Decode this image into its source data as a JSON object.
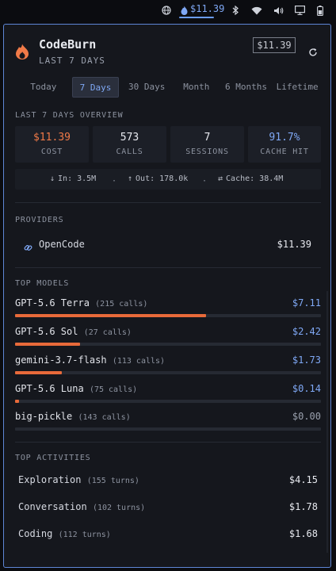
{
  "menubar": {
    "amount": "$11.39",
    "icons": [
      "globe-icon",
      "flame-icon",
      "bluetooth-icon",
      "wifi-icon",
      "volume-icon",
      "display-icon",
      "battery-icon"
    ]
  },
  "header": {
    "title": "CodeBurn",
    "subtitle": "LAST 7 DAYS",
    "total": "$11.39"
  },
  "tabs": [
    {
      "label": "Today",
      "active": false
    },
    {
      "label": "7 Days",
      "active": true
    },
    {
      "label": "30 Days",
      "active": false
    },
    {
      "label": "Month",
      "active": false
    },
    {
      "label": "6 Months",
      "active": false
    },
    {
      "label": "Lifetime",
      "active": false
    }
  ],
  "overview": {
    "heading": "LAST 7 DAYS OVERVIEW",
    "stats": [
      {
        "value": "$11.39",
        "label": "COST",
        "color": "#f07a48"
      },
      {
        "value": "573",
        "label": "CALLS",
        "color": "#e8eaf0"
      },
      {
        "value": "7",
        "label": "SESSIONS",
        "color": "#e8eaf0"
      },
      {
        "value": "91.7%",
        "label": "CACHE HIT",
        "color": "#7fa8f5"
      }
    ],
    "tokens": {
      "in": "In: 3.5M",
      "out": "Out: 178.0k",
      "cache": "Cache: 38.4M",
      "sep": "·"
    }
  },
  "providers": {
    "heading": "PROVIDERS",
    "items": [
      {
        "name": "OpenCode",
        "cost": "$11.39"
      }
    ]
  },
  "models": {
    "heading": "TOP MODELS",
    "items": [
      {
        "name": "GPT-5.6 Terra",
        "calls": "(215 calls)",
        "cost": "$7.11",
        "share": 0.624
      },
      {
        "name": "GPT-5.6 Sol",
        "calls": "(27 calls)",
        "cost": "$2.42",
        "share": 0.212
      },
      {
        "name": "gemini-3.7-flash",
        "calls": "(113 calls)",
        "cost": "$1.73",
        "share": 0.152
      },
      {
        "name": "GPT-5.6 Luna",
        "calls": "(75 calls)",
        "cost": "$0.14",
        "share": 0.012
      },
      {
        "name": "big-pickle",
        "calls": "(143 calls)",
        "cost": "$0.00",
        "share": 0
      }
    ]
  },
  "activities": {
    "heading": "TOP ACTIVITIES",
    "items": [
      {
        "name": "Exploration",
        "turns": "(155 turns)",
        "cost": "$4.15"
      },
      {
        "name": "Conversation",
        "turns": "(102 turns)",
        "cost": "$1.78"
      },
      {
        "name": "Coding",
        "turns": "(112 turns)",
        "cost": "$1.68"
      }
    ]
  }
}
